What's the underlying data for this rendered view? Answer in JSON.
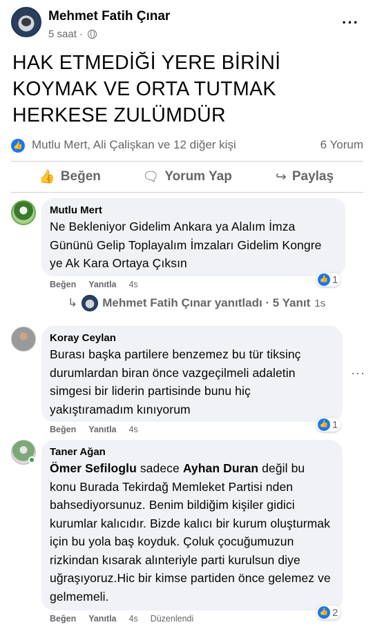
{
  "post": {
    "author": "Mehmet Fatih Çınar",
    "time": "5 saat ·",
    "text": "HAK ETMEDİĞİ YERE BİRİNİ KOYMAK VE ORTA TUTMAK HERKESE ZULÜMDÜR",
    "reactions_text": "Mutlu Mert, Ali Çalişkan ve 12 diğer kişi",
    "comment_count": "6 Yorum"
  },
  "actions": {
    "like": "Beğen",
    "comment": "Yorum Yap",
    "share": "Paylaş"
  },
  "comments": [
    {
      "name": "Mutlu Mert",
      "text": "Ne Bekleniyor Gidelim Ankara ya Alalım İmza Gününü Gelip Toplayalım İmzaları Gidelim Kongre ye Ak Kara Ortaya Çıksın",
      "like": "Beğen",
      "reply": "Yanıtla",
      "time": "4s",
      "reactions": "1"
    },
    {
      "name": "Koray Ceylan",
      "text": "Burası başka partilere benzemez bu tür tiksinç durumlardan biran önce vazgeçilmeli adaletin simgesi bir liderin partisinde bunu hiç yakıştıramadım kınıyorum",
      "like": "Beğen",
      "reply": "Yanıtla",
      "time": "4s",
      "reactions": "1"
    },
    {
      "name": "Taner Ağan",
      "mention1": "Ömer Sefiloglu",
      "text_part1": " sadece ",
      "mention2": "Ayhan Duran",
      "text_part2": " değil bu konu Burada Tekirdağ Memleket Partisi nden bahsediyorsunuz. Benim bildiğim kişiler gidici kurumlar kalıcıdır. Bizde kalıcı bir kurum oluşturmak için bu yola baş koyduk. Çoluk çocuğumuzun rizkindan kısarak alınteriyle parti kurulsun diye uğraşıyoruz.Hic bir kimse partiden önce gelemez ve gelmemeli.",
      "like": "Beğen",
      "reply": "Yanıtla",
      "time": "4s",
      "edited": "Düzenlendi",
      "reactions": "2"
    }
  ],
  "reply_summary": {
    "text": "Mehmet Fatih Çınar yanıtladı · 5 Yanıt",
    "time": "1s"
  },
  "colors": {
    "accent": "#1877f2",
    "bubble": "#f0f2f5",
    "muted": "#65676b",
    "online": "#31a24c"
  }
}
